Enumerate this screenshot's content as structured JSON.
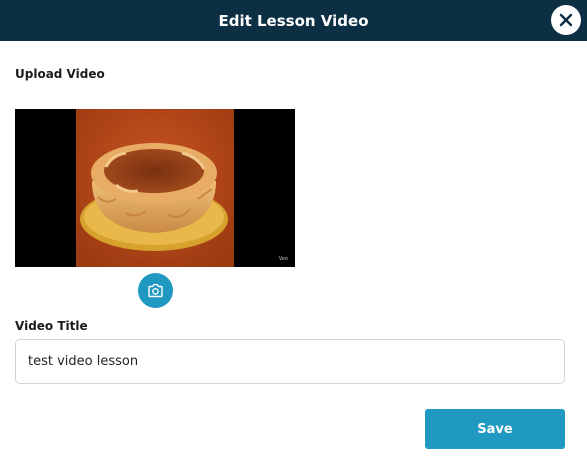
{
  "modal": {
    "title": "Edit Lesson Video",
    "close_icon": "close-icon"
  },
  "upload": {
    "label": "Upload Video",
    "thumbnail_icon": "video-thumbnail-cheesecake",
    "watermark": "Veo",
    "camera_icon": "camera-icon"
  },
  "video_title": {
    "label": "Video Title",
    "value": "test video lesson",
    "placeholder": ""
  },
  "actions": {
    "save_label": "Save"
  },
  "colors": {
    "header_bg": "#0d2f44",
    "accent": "#1f99c1",
    "thumbnail_bg": "#b8461a",
    "cake_crust": "#e0a360",
    "cake_top": "#8c3d14",
    "board": "#d6a12c"
  }
}
